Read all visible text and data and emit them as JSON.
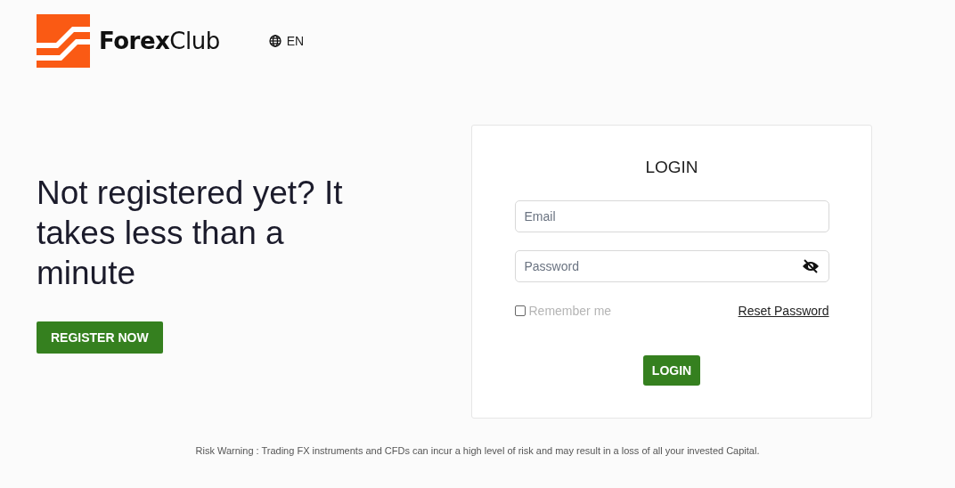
{
  "header": {
    "logo": "**Forex**Club",
    "language": "EN"
  },
  "promo": {
    "headline": "Not registered yet? It takes less than a minute",
    "button": "REGISTER NOW"
  },
  "login": {
    "title": "LOGIN",
    "email": {
      "placeholder": "Email"
    },
    "password": {
      "placeholder": "Password"
    },
    "remember": {
      "label": "Remember me",
      "checked": false
    },
    "reset_link": "Reset Password",
    "button": "LOGIN"
  },
  "footer": {
    "risk_warning": "Risk Warning : Trading FX instruments and CFDs can incur a high level of risk and may result in a loss of all your invested Capital."
  }
}
